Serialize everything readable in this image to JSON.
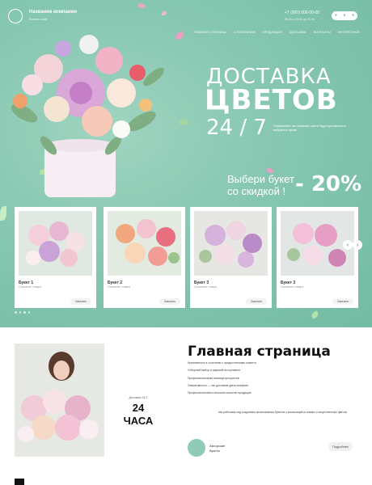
{
  "header": {
    "brand_name": "Название компании",
    "brand_sub": "Бизнес-сайт",
    "phone": "+7 (000) 000-00-00",
    "phone_sub": "Пн-Вс с 09:00 до 21:00",
    "social_icons": [
      "vk-icon",
      "whatsapp-icon",
      "telegram-icon"
    ]
  },
  "nav": {
    "items": [
      "ГЛАВНАЯ СТРАНИЦА",
      "О КОМПАНИИ",
      "ПРОДУКЦИЯ",
      "ДОСТАВКА",
      "КОНТАКТЫ",
      "ИНТЕРЕСНОЕ"
    ]
  },
  "hero": {
    "title_1": "ДОСТАВКА",
    "title_2": "ЦВЕТОВ",
    "title_3": "24 / 7",
    "tagline": "Оформляйте, мы привезём, цветы будут доставлены в выбранное время",
    "promo_line_1": "Выбери букет",
    "promo_line_2": "со скидкой !",
    "promo_discount": "- 20%"
  },
  "cards": [
    {
      "name": "Букет 1",
      "desc": "Описание товара",
      "button": "Заказать"
    },
    {
      "name": "Букет 2",
      "desc": "Описание товара",
      "button": "Заказать"
    },
    {
      "name": "Букет 3",
      "desc": "Описание товара",
      "button": "Заказать"
    },
    {
      "name": "Букет 3",
      "desc": "Описание товара",
      "button": "Заказать"
    }
  ],
  "about": {
    "title": "Главная страница",
    "list": [
      "Креативность в сочетании с предпочтениями клиента",
      "Отборный выбор и широкий ассортимент",
      "Профессиональная команда флористов",
      "Оперативность — мы доставим цветы вовремя",
      "Профессионализм и высокое качество продукции"
    ],
    "badge_caption": "Доставка 24/7",
    "badge_hours": "24",
    "badge_unit": "ЧАСА",
    "text": "Мы работаем над созданием эксклюзивных букетов и композиций из живых и искусственных цветов.",
    "author_label_1": "Авторские",
    "author_label_2": "букеты",
    "more_button": "Подробнее"
  },
  "colors": {
    "accent": "#86c7b1",
    "white": "#ffffff"
  }
}
